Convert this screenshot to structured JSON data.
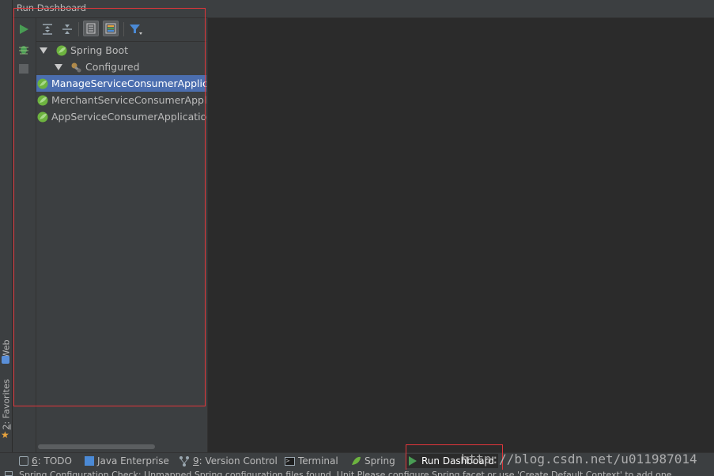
{
  "panel": {
    "title": "Run Dashboard"
  },
  "left_stripe": {
    "web_label": "Web",
    "favorites_num": "2",
    "favorites_label": ": Favorites"
  },
  "tree": {
    "items": [
      {
        "label": "Spring Boot",
        "expanded": true,
        "icon": "spring-boot-icon"
      },
      {
        "label": "Configured",
        "expanded": true,
        "icon": "configured-icon"
      },
      {
        "label": "ManageServiceConsumerApplication",
        "selected": true,
        "icon": "spring-app-icon"
      },
      {
        "label": "MerchantServiceConsumerApplication",
        "icon": "spring-app-icon"
      },
      {
        "label": "AppServiceConsumerApplication",
        "icon": "spring-app-icon"
      }
    ]
  },
  "bottom_tabs": {
    "todo_num": "6",
    "todo_label": ": TODO",
    "java_enterprise": "Java Enterprise",
    "vc_num": "9",
    "vc_label": ": Version Control",
    "terminal": "Terminal",
    "spring": "Spring",
    "run_dashboard": "Run Dashboard"
  },
  "watermark": "http://blog.csdn.net/u011987014",
  "status_text": "Spring Configuration Check: Unmapped Spring configuration files found. Unit Please configure Spring facet or use 'Create Default Context' to add one",
  "colors": {
    "selection": "#4b6eaf",
    "run_green": "#499c54",
    "spring_green": "#6db33f",
    "highlight_red": "#e0363a"
  }
}
